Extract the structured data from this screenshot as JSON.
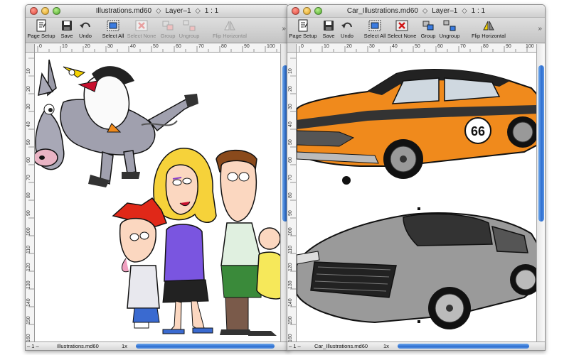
{
  "windows": [
    {
      "id": "left",
      "title": {
        "filename": "Illustrations.md60",
        "separator": "◇",
        "layer": "Layer–1",
        "zoom": "1 : 1"
      },
      "toolbar": [
        {
          "label": "Page Setup",
          "icon": "page-setup-icon",
          "enabled": true
        },
        {
          "label": "Save",
          "icon": "save-icon",
          "enabled": true
        },
        {
          "label": "Undo",
          "icon": "undo-icon",
          "enabled": true
        },
        {
          "label": "Select All",
          "icon": "select-all-icon",
          "enabled": true
        },
        {
          "label": "Select None",
          "icon": "select-none-icon",
          "enabled": false
        },
        {
          "label": "Group",
          "icon": "group-icon",
          "enabled": false
        },
        {
          "label": "Ungroup",
          "icon": "ungroup-icon",
          "enabled": false
        },
        {
          "label": "Flip Horizontal",
          "icon": "flip-horizontal-icon",
          "enabled": false
        }
      ],
      "ruler_h": [
        "0",
        "10",
        "20",
        "30",
        "40",
        "50",
        "60",
        "70",
        "80",
        "90",
        "100"
      ],
      "ruler_v": [
        "10",
        "20",
        "30",
        "40",
        "50",
        "60",
        "70",
        "80",
        "90",
        "100",
        "110",
        "120",
        "130",
        "140",
        "150",
        "160"
      ],
      "status": {
        "zoom_control": "– 1 –",
        "filename": "Illustrations.md60",
        "scale": "1x"
      },
      "scroll_v": 0.0
    },
    {
      "id": "right",
      "title": {
        "filename": "Car_Illustrations.md60",
        "separator": "◇",
        "layer": "Layer–1",
        "zoom": "1 : 1"
      },
      "toolbar": [
        {
          "label": "Page Setup",
          "icon": "page-setup-icon",
          "enabled": true
        },
        {
          "label": "Save",
          "icon": "save-icon",
          "enabled": true
        },
        {
          "label": "Undo",
          "icon": "undo-icon",
          "enabled": true
        },
        {
          "label": "Select All",
          "icon": "select-all-icon",
          "enabled": true
        },
        {
          "label": "Select None",
          "icon": "select-none-icon",
          "enabled": true
        },
        {
          "label": "Group",
          "icon": "group-icon",
          "enabled": true
        },
        {
          "label": "Ungroup",
          "icon": "ungroup-icon",
          "enabled": true
        },
        {
          "label": "Flip Horizontal",
          "icon": "flip-horizontal-icon",
          "enabled": true
        }
      ],
      "ruler_h": [
        "0",
        "10",
        "20",
        "30",
        "40",
        "50",
        "60",
        "70",
        "80",
        "90",
        "100"
      ],
      "ruler_v": [
        "10",
        "20",
        "30",
        "40",
        "50",
        "60",
        "70",
        "80",
        "90",
        "100",
        "110",
        "120",
        "130",
        "140",
        "150",
        "160"
      ],
      "status": {
        "zoom_control": "– 1 –",
        "filename": "Car_Illustrations.md60",
        "scale": "1x"
      },
      "scroll_v": 0.0
    }
  ],
  "colors": {
    "scroll_blue": "#2f6fd0",
    "mustang_orange": "#f08a1c",
    "aston_gray": "#9a9a9a",
    "shirt_purple": "#7a55e0"
  }
}
